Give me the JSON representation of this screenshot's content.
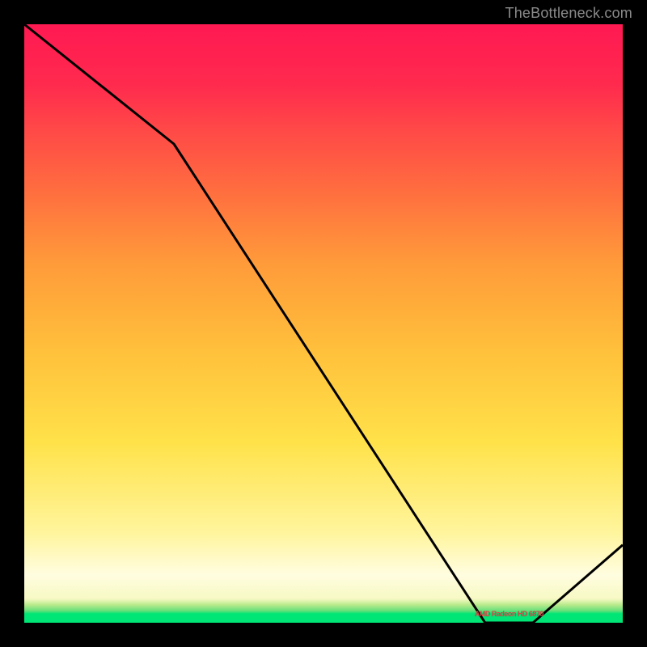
{
  "watermark": "TheBottleneck.com",
  "line_label": "AMD Radeon HD 6870",
  "chart_data": {
    "type": "line",
    "xlim": [
      0,
      100
    ],
    "ylim": [
      0,
      100
    ],
    "series": [
      {
        "name": "curve",
        "x": [
          0,
          25,
          77,
          85,
          100
        ],
        "values": [
          100,
          80,
          0,
          0,
          13
        ]
      }
    ],
    "label_position_pct": {
      "x": 81,
      "y": 1.5
    },
    "title": "",
    "xlabel": "",
    "ylabel": ""
  },
  "colors": {
    "curve": "#000000",
    "label": "#d44444",
    "gradient_top": "#ff1952",
    "gradient_mid": "#ffe24a",
    "gradient_bottom": "#00e676"
  }
}
